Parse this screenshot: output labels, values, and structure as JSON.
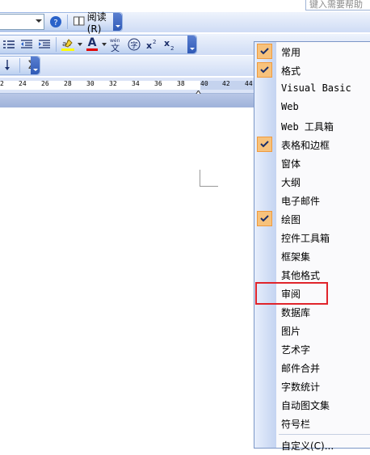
{
  "help_box": {
    "text": "键入需要帮助"
  },
  "toolbar": {
    "read_label": "阅读(R)",
    "font_color_glyph": "A",
    "sigma_glyph": "Σ"
  },
  "ruler": {
    "ticks": [
      "2",
      "24",
      "26",
      "28",
      "30",
      "32",
      "34",
      "36",
      "38",
      "40",
      "42",
      "44"
    ]
  },
  "menu": {
    "items": [
      {
        "label": "常用",
        "checked": true
      },
      {
        "label": "格式",
        "checked": true
      },
      {
        "label": "Visual Basic",
        "checked": false
      },
      {
        "label": "Web",
        "checked": false
      },
      {
        "label": "Web 工具箱",
        "checked": false
      },
      {
        "label": "表格和边框",
        "checked": true
      },
      {
        "label": "窗体",
        "checked": false
      },
      {
        "label": "大纲",
        "checked": false
      },
      {
        "label": "电子邮件",
        "checked": false
      },
      {
        "label": "绘图",
        "checked": true
      },
      {
        "label": "控件工具箱",
        "checked": false
      },
      {
        "label": "框架集",
        "checked": false
      },
      {
        "label": "其他格式",
        "checked": false
      },
      {
        "label": "审阅",
        "checked": false
      },
      {
        "label": "数据库",
        "checked": false
      },
      {
        "label": "图片",
        "checked": false
      },
      {
        "label": "艺术字",
        "checked": false
      },
      {
        "label": "邮件合并",
        "checked": false
      },
      {
        "label": "字数统计",
        "checked": false
      },
      {
        "label": "自动图文集",
        "checked": false
      },
      {
        "label": "符号栏",
        "checked": false
      }
    ],
    "customize_label": "自定义(C)...",
    "accent_check_bg": "#f7c27c",
    "highlight_color": "#e0242b"
  }
}
